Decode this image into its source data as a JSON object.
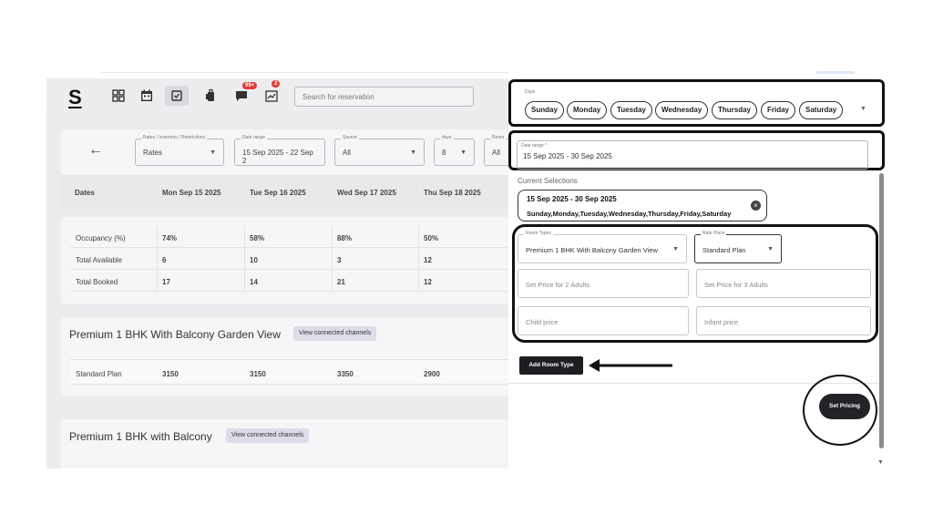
{
  "topbar": {
    "logo": "S",
    "search_placeholder": "Search for reservation",
    "notif_badge": "99+",
    "msg_badge": "2",
    "icons": [
      "grid-icon",
      "calendar-icon",
      "calendar-check-icon",
      "luggage-icon",
      "chat-icon",
      "chart-icon"
    ]
  },
  "filters": {
    "rates_label": "Rates / Inventory / Restrictions",
    "rates_value": "Rates",
    "date_label": "Date range",
    "date_value": "15 Sep 2025 - 22 Sep 2",
    "source_label": "Source",
    "source_value": "All",
    "days_label": "days",
    "days_value": "8",
    "room_label": "Room",
    "room_value": "All"
  },
  "dates_header": {
    "label": "Dates",
    "cols": [
      "Mon Sep 15 2025",
      "Tue Sep 16 2025",
      "Wed Sep 17 2025",
      "Thu Sep 18 2025"
    ]
  },
  "stats": [
    {
      "label": "Occupancy (%)",
      "values": [
        "74%",
        "58%",
        "88%",
        "50%"
      ]
    },
    {
      "label": "Total Available",
      "values": [
        "6",
        "10",
        "3",
        "12"
      ]
    },
    {
      "label": "Total Booked",
      "values": [
        "17",
        "14",
        "21",
        "12"
      ]
    }
  ],
  "rooms": [
    {
      "title": "Premium 1 BHK With Balcony Garden View",
      "button": "View connected channels",
      "plan": "Standard Plan",
      "values": [
        "3150",
        "3150",
        "3350",
        "2900"
      ]
    },
    {
      "title": "Premium 1 BHK with Balcony",
      "button": "View connected channels"
    }
  ],
  "panel": {
    "days_label": "Days",
    "days": [
      "Sunday",
      "Monday",
      "Tuesday",
      "Wednesday",
      "Thursday",
      "Friday",
      "Saturday"
    ],
    "date_range_label": "Date range *",
    "date_range_value": "15 Sep 2025 - 30 Sep 2025",
    "current_selections_label": "Current Selections",
    "selection_range": "15 Sep 2025 - 30 Sep 2025",
    "selection_days": "Sunday,Monday,Tuesday,Wednesday,Thursday,Friday,Saturday",
    "room_types_label": "Room Types",
    "room_types_value": "Premium 1 BHK With Balcony Garden View",
    "rate_plans_label": "Rate Plans",
    "rate_plans_value": "Standard Plan",
    "price_2_placeholder": "Set Price for 2 Adults",
    "price_3_placeholder": "Set Price for 3 Adults",
    "child_placeholder": "Child price",
    "infant_placeholder": "Infant price",
    "add_room_type": "Add Room Type",
    "set_pricing": "Set Pricing"
  }
}
